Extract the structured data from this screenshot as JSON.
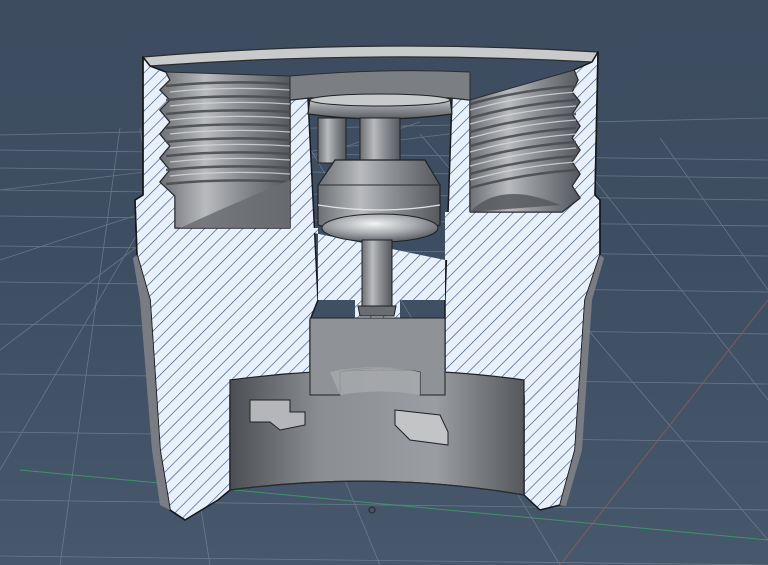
{
  "viewport": {
    "background_top": "#3d4c5f",
    "background_bottom": "#47586c",
    "grid_color": "#8896a6",
    "axis_x_color": "#3fa06a",
    "axis_y_color": "#a05a5a"
  },
  "model": {
    "section_fill": "#e8f1fb",
    "hatch_color": "#1f3a6a",
    "body_color": "#a3a5a8",
    "shadow_color": "#5c5f63",
    "highlight_color": "#e6e7e9"
  }
}
